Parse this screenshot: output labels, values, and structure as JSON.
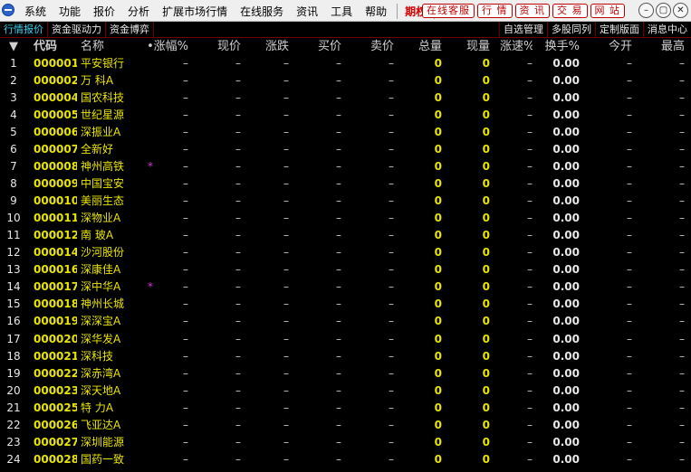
{
  "menu": [
    "系统",
    "功能",
    "报价",
    "分析",
    "扩展市场行情",
    "在线服务",
    "资讯",
    "工具",
    "帮助"
  ],
  "menu_highlight": "期权",
  "quick_links": [
    "在线客服",
    "行 情",
    "资 讯",
    "交 易",
    "网 站"
  ],
  "window_controls": [
    "minimize-icon",
    "restore-icon",
    "close-icon"
  ],
  "tabs": [
    "行情报价",
    "资金驱动力",
    "资金博弈"
  ],
  "right_tabs": [
    "自选管理",
    "多股同列",
    "定制版面",
    "消息中心"
  ],
  "columns": {
    "idx": "▼",
    "code": "代码",
    "name": "名称",
    "dot": "•",
    "pct": "涨幅%",
    "price": "现价",
    "chg": "涨跌",
    "bid": "买价",
    "ask": "卖价",
    "vol": "总量",
    "cur": "现量",
    "spd": "涨速%",
    "turn": "换手%",
    "open": "今开",
    "high": "最高"
  },
  "empty_value": "–",
  "rows": [
    {
      "idx": "1",
      "code": "000001",
      "name": "平安银行",
      "mark": "",
      "vol": "0",
      "cur": "0",
      "turn": "0.00"
    },
    {
      "idx": "2",
      "code": "000002",
      "name": "万 科A",
      "mark": "",
      "vol": "0",
      "cur": "0",
      "turn": "0.00"
    },
    {
      "idx": "3",
      "code": "000004",
      "name": "国农科技",
      "mark": "",
      "vol": "0",
      "cur": "0",
      "turn": "0.00"
    },
    {
      "idx": "4",
      "code": "000005",
      "name": "世纪星源",
      "mark": "",
      "vol": "0",
      "cur": "0",
      "turn": "0.00"
    },
    {
      "idx": "5",
      "code": "000006",
      "name": "深振业A",
      "mark": "",
      "vol": "0",
      "cur": "0",
      "turn": "0.00"
    },
    {
      "idx": "6",
      "code": "000007",
      "name": "全新好",
      "mark": "",
      "vol": "0",
      "cur": "0",
      "turn": "0.00"
    },
    {
      "idx": "7",
      "code": "000008",
      "name": "神州高铁",
      "mark": "*",
      "vol": "0",
      "cur": "0",
      "turn": "0.00"
    },
    {
      "idx": "8",
      "code": "000009",
      "name": "中国宝安",
      "mark": "",
      "vol": "0",
      "cur": "0",
      "turn": "0.00"
    },
    {
      "idx": "9",
      "code": "000010",
      "name": "美丽生态",
      "mark": "",
      "vol": "0",
      "cur": "0",
      "turn": "0.00"
    },
    {
      "idx": "10",
      "code": "000011",
      "name": "深物业A",
      "mark": "",
      "vol": "0",
      "cur": "0",
      "turn": "0.00"
    },
    {
      "idx": "11",
      "code": "000012",
      "name": "南 玻A",
      "mark": "",
      "vol": "0",
      "cur": "0",
      "turn": "0.00"
    },
    {
      "idx": "12",
      "code": "000014",
      "name": "沙河股份",
      "mark": "",
      "vol": "0",
      "cur": "0",
      "turn": "0.00"
    },
    {
      "idx": "13",
      "code": "000016",
      "name": "深康佳A",
      "mark": "",
      "vol": "0",
      "cur": "0",
      "turn": "0.00"
    },
    {
      "idx": "14",
      "code": "000017",
      "name": "深中华A",
      "mark": "*",
      "vol": "0",
      "cur": "0",
      "turn": "0.00"
    },
    {
      "idx": "15",
      "code": "000018",
      "name": "神州长城",
      "mark": "",
      "vol": "0",
      "cur": "0",
      "turn": "0.00"
    },
    {
      "idx": "16",
      "code": "000019",
      "name": "深深宝A",
      "mark": "",
      "vol": "0",
      "cur": "0",
      "turn": "0.00"
    },
    {
      "idx": "17",
      "code": "000020",
      "name": "深华发A",
      "mark": "",
      "vol": "0",
      "cur": "0",
      "turn": "0.00"
    },
    {
      "idx": "18",
      "code": "000021",
      "name": "深科技",
      "mark": "",
      "vol": "0",
      "cur": "0",
      "turn": "0.00"
    },
    {
      "idx": "19",
      "code": "000022",
      "name": "深赤湾A",
      "mark": "",
      "vol": "0",
      "cur": "0",
      "turn": "0.00"
    },
    {
      "idx": "20",
      "code": "000023",
      "name": "深天地A",
      "mark": "",
      "vol": "0",
      "cur": "0",
      "turn": "0.00"
    },
    {
      "idx": "21",
      "code": "000025",
      "name": "特 力A",
      "mark": "",
      "vol": "0",
      "cur": "0",
      "turn": "0.00"
    },
    {
      "idx": "22",
      "code": "000026",
      "name": "飞亚达A",
      "mark": "",
      "vol": "0",
      "cur": "0",
      "turn": "0.00"
    },
    {
      "idx": "23",
      "code": "000027",
      "name": "深圳能源",
      "mark": "",
      "vol": "0",
      "cur": "0",
      "turn": "0.00"
    },
    {
      "idx": "24",
      "code": "000028",
      "name": "国药一致",
      "mark": "",
      "vol": "0",
      "cur": "0",
      "turn": "0.00"
    }
  ]
}
